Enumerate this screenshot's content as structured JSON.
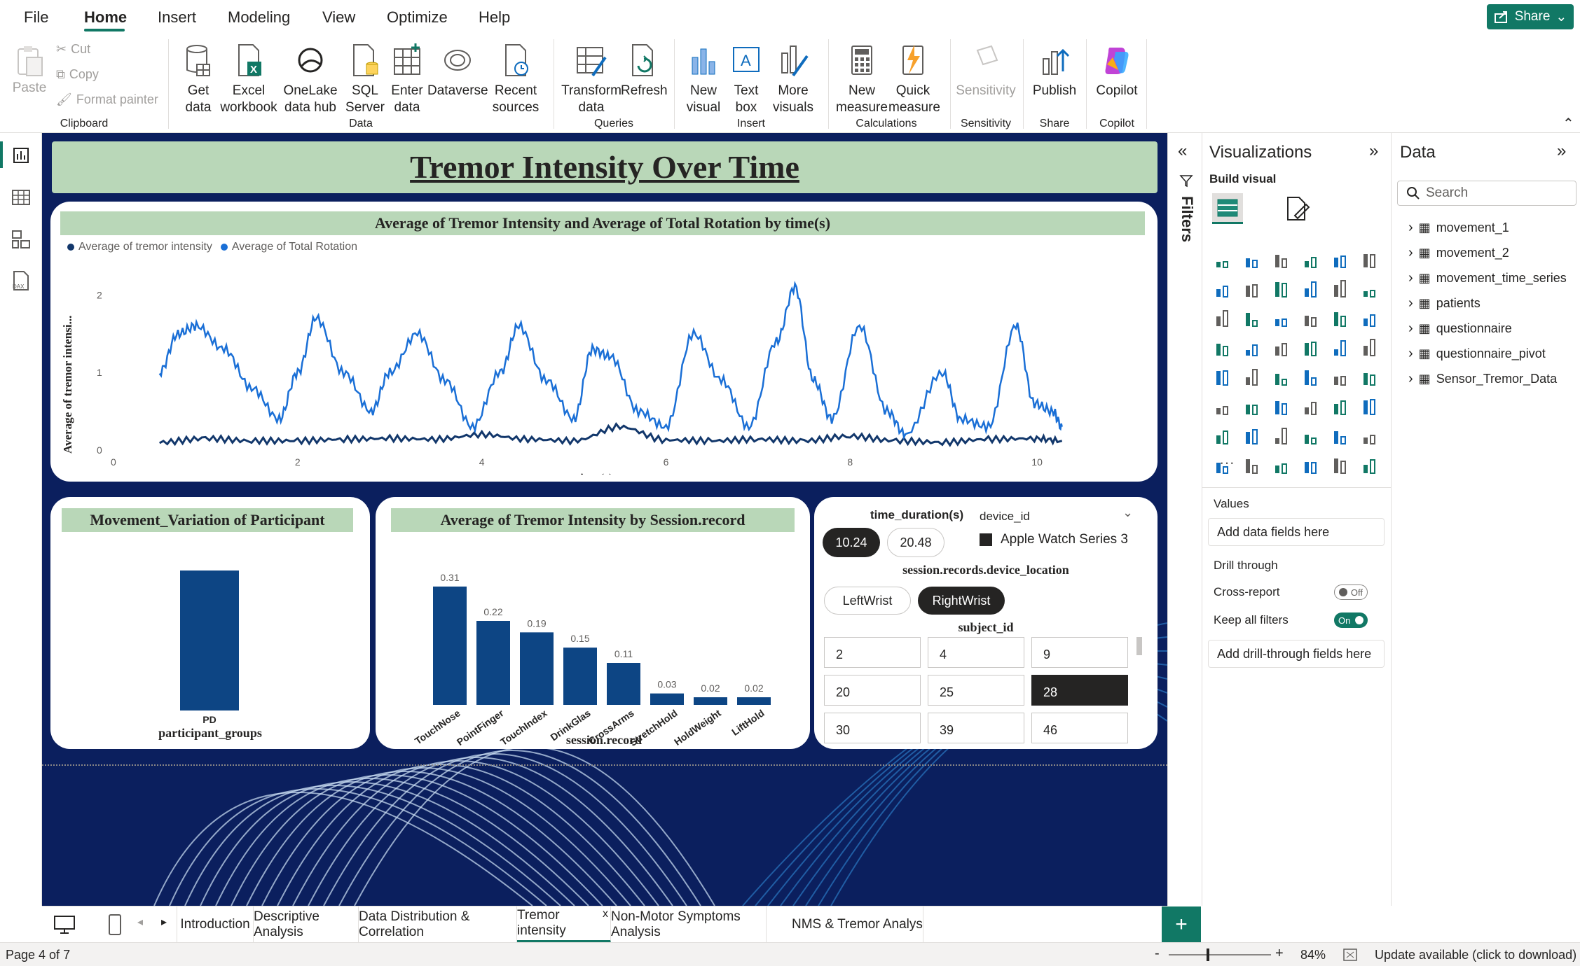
{
  "menu": {
    "items": [
      "File",
      "Home",
      "Insert",
      "Modeling",
      "View",
      "Optimize",
      "Help"
    ],
    "active": "Home",
    "share": "Share"
  },
  "ribbon": {
    "clipboard": {
      "paste": "Paste",
      "cut": "Cut",
      "copy": "Copy",
      "format_painter": "Format painter",
      "group": "Clipboard"
    },
    "data": {
      "get_data": "Get data",
      "excel": "Excel workbook",
      "onelake": "OneLake data hub",
      "sql": "SQL Server",
      "enter": "Enter data",
      "dataverse": "Dataverse",
      "recent": "Recent sources",
      "group": "Data"
    },
    "queries": {
      "transform": "Transform data",
      "refresh": "Refresh",
      "group": "Queries"
    },
    "insert": {
      "new_visual": "New visual",
      "text_box": "Text box",
      "more_visuals": "More visuals",
      "group": "Insert"
    },
    "calculations": {
      "new_measure": "New measure",
      "quick_measure": "Quick measure",
      "group": "Calculations"
    },
    "sensitivity": {
      "label": "Sensitivity",
      "group": "Sensitivity"
    },
    "share": {
      "publish": "Publish",
      "group": "Share"
    },
    "copilot": {
      "label": "Copilot",
      "group": "Copilot"
    }
  },
  "report": {
    "title": "Tremor Intensity Over Time",
    "line_chart_title": "Average of Tremor Intensity and Average of Total Rotation by time(s)",
    "bar1_title": "Movement_Variation of Participant",
    "bar2_title": "Average of Tremor Intensity by Session.record",
    "slicer": {
      "time_label": "time_duration(s)",
      "time_options": [
        "10.24",
        "20.48"
      ],
      "time_selected": "10.24",
      "device_label": "device_id",
      "device_value": "Apple Watch Series 3",
      "location_label": "session.records.device_location",
      "location_options": [
        "LeftWrist",
        "RightWrist"
      ],
      "location_selected": "RightWrist",
      "subject_label": "subject_id",
      "subjects": [
        "2",
        "4",
        "9",
        "20",
        "25",
        "28",
        "30",
        "39",
        "46"
      ],
      "subject_selected": "28"
    }
  },
  "chart_data": [
    {
      "type": "line",
      "title": "Average of Tremor Intensity and Average of Total Rotation by time(s)",
      "xlabel": "time(s)",
      "ylabel": "Average of tremor intensi...",
      "xlim": [
        0,
        10.5
      ],
      "ylim": [
        0,
        2.3
      ],
      "xticks": [
        "0",
        "2",
        "4",
        "6",
        "8",
        "10"
      ],
      "yticks": [
        "0",
        "1",
        "2"
      ],
      "legend_position": "top-left",
      "series": [
        {
          "name": "Average of tremor intensity",
          "color": "#12376b",
          "x": [
            0.5,
            1,
            1.5,
            2,
            2.5,
            3,
            3.5,
            4,
            4.5,
            5,
            5.5,
            6,
            6.5,
            7,
            7.5,
            8,
            8.5,
            9,
            9.5,
            10,
            10.3
          ],
          "y": [
            0.1,
            0.15,
            0.12,
            0.12,
            0.14,
            0.15,
            0.14,
            0.2,
            0.14,
            0.12,
            0.3,
            0.13,
            0.12,
            0.14,
            0.12,
            0.18,
            0.12,
            0.1,
            0.14,
            0.15,
            0.12
          ]
        },
        {
          "name": "Average of Total Rotation",
          "color": "#1a6fd6",
          "x": [
            0.5,
            0.7,
            0.9,
            1.2,
            1.5,
            1.8,
            2.0,
            2.2,
            2.5,
            2.8,
            3.0,
            3.3,
            3.6,
            3.9,
            4.2,
            4.4,
            4.7,
            5.0,
            5.2,
            5.4,
            5.7,
            6.0,
            6.3,
            6.6,
            6.9,
            7.2,
            7.4,
            7.6,
            7.8,
            8.1,
            8.4,
            8.6,
            9.0,
            9.2,
            9.5,
            9.8,
            10.0,
            10.2,
            10.3
          ],
          "y": [
            1.0,
            1.5,
            1.6,
            1.3,
            0.8,
            0.4,
            1.0,
            1.7,
            1.0,
            0.5,
            1.0,
            1.5,
            0.9,
            0.3,
            1.0,
            1.6,
            0.9,
            0.4,
            1.3,
            1.2,
            0.5,
            0.3,
            1.5,
            0.9,
            0.3,
            1.4,
            2.1,
            0.9,
            0.4,
            1.6,
            0.5,
            0.2,
            1.0,
            0.4,
            0.3,
            1.6,
            0.6,
            0.5,
            0.3
          ]
        }
      ]
    },
    {
      "type": "bar",
      "title": "Movement_Variation of Participant",
      "xlabel": "participant_groups",
      "categories": [
        "PD"
      ],
      "values": [
        1
      ]
    },
    {
      "type": "bar",
      "title": "Average of Tremor Intensity by Session.record",
      "xlabel": "session.record",
      "categories": [
        "TouchNose",
        "PointFinger",
        "TouchIndex",
        "DrinkGlas",
        "CrossArms",
        "StretchHold",
        "HoldWeight",
        "LiftHold"
      ],
      "values": [
        0.31,
        0.22,
        0.19,
        0.15,
        0.11,
        0.03,
        0.02,
        0.02
      ],
      "data_labels": [
        "0.31",
        "0.22",
        "0.19",
        "0.15",
        "0.11",
        "0.03",
        "0.02",
        "0.02"
      ],
      "color": "#0d4584"
    }
  ],
  "filters_label": "Filters",
  "visualizations": {
    "title": "Visualizations",
    "build_visual": "Build visual",
    "values_label": "Values",
    "values_placeholder": "Add data fields here",
    "drill_through": "Drill through",
    "cross_report": "Cross-report",
    "cross_report_state": "Off",
    "keep_filters": "Keep all filters",
    "keep_filters_state": "On",
    "drill_placeholder": "Add drill-through fields here"
  },
  "data_pane": {
    "title": "Data",
    "search_placeholder": "Search",
    "tables": [
      "movement_1",
      "movement_2",
      "movement_time_series",
      "patients",
      "questionnaire",
      "questionnaire_pivot",
      "Sensor_Tremor_Data"
    ]
  },
  "tabs": [
    "Introduction",
    "Descriptive Analysis",
    "Data Distribution & Correlation",
    "Tremor intensity",
    "Non-Motor Symptoms Analysis",
    "NMS & Tremor Analysis"
  ],
  "active_tab": "Tremor intensity",
  "status": {
    "page": "Page 4 of 7",
    "zoom": "84%",
    "update": "Update available (click to download)"
  }
}
